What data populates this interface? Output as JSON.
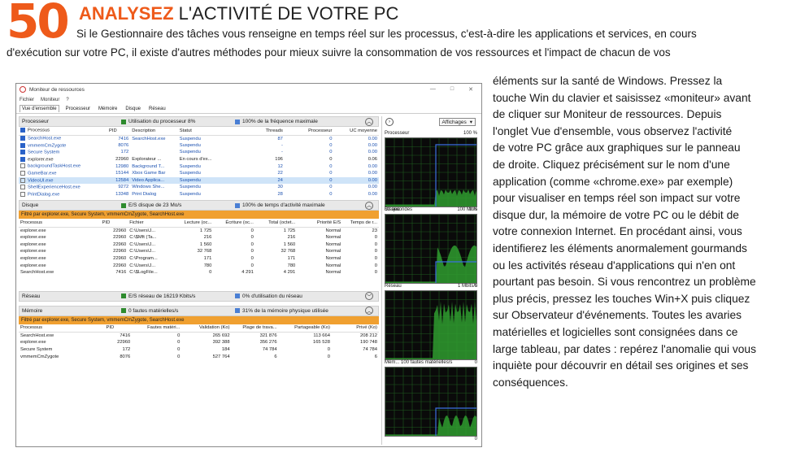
{
  "header": {
    "number": "50",
    "title_strong": "ANALYSEZ",
    "title_rest": "L'ACTIVITÉ DE VOTRE PC"
  },
  "intro": {
    "line1": "Si le Gestionnaire des tâches vous renseigne en temps réel sur les processus, c'est-à-dire les applications et services, en cours",
    "line2": "d'exécution sur votre PC, il existe d'autres méthodes pour mieux suivre la consommation de vos ressources et l'impact de chacun de vos"
  },
  "body_lines": [
    "éléments sur la santé de Windows. Pressez la",
    "touche Win du clavier et saisissez «moniteur» avant",
    "de cliquer sur Moniteur de ressources. Depuis",
    "l'onglet Vue d'ensemble, vous observez l'activité",
    "de votre PC grâce aux graphiques sur le panneau",
    "de droite. Cliquez précisément sur le nom d'une",
    "application (comme «chrome.exe» par exemple)",
    "pour visualiser en temps réel son impact sur votre",
    "disque dur, la mémoire de votre PC ou le débit de",
    "votre connexion Internet. En procédant ainsi, vous",
    "identifierez les éléments anormalement gourmands",
    "ou les activités réseau d'applications qui n'en ont",
    "pourtant pas besoin. Si vous rencontrez un problème",
    "plus précis, pressez les touches Win+X puis cliquez",
    "sur Observateur d'événements. Toutes les avaries",
    "matérielles et logicielles sont consignées dans ce",
    "large tableau, par dates : repérez l'anomalie qui vous",
    "inquiète pour découvrir en détail ses origines et ses",
    "conséquences."
  ],
  "window": {
    "title": "Moniteur de ressources",
    "controls": [
      "—",
      "□",
      "✕"
    ],
    "menu": [
      "Fichier",
      "Moniteur",
      "?"
    ],
    "tabs": [
      "Vue d'ensemble",
      "Processeur",
      "Mémoire",
      "Disque",
      "Réseau"
    ],
    "cpu": {
      "title": "Processeur",
      "info1": "Utilisation du processeur 8%",
      "info2": "100% de la fréquence maximale",
      "headers": [
        "Processus",
        "PID",
        "Description",
        "Statut",
        "Threads",
        "Processeur",
        "UC moyenne"
      ],
      "rows": [
        [
          "SearchHost.exe",
          "7416",
          "SearchHost.exe",
          "Suspendu",
          "87",
          "0",
          "0.00"
        ],
        [
          "vmmemCmZygote",
          "8076",
          "",
          "Suspendu",
          "-",
          "0",
          "0.00"
        ],
        [
          "Secure System",
          "172",
          "",
          "Suspendu",
          "-",
          "0",
          "0.00"
        ],
        [
          "explorer.exe",
          "22960",
          "Explorateur ...",
          "En cours d'ex...",
          "196",
          "0",
          "0.06"
        ],
        [
          "backgroundTaskHost.exe",
          "12980",
          "Background T...",
          "Suspendu",
          "12",
          "0",
          "0.00"
        ],
        [
          "GameBar.exe",
          "15144",
          "Xbox Game Bar",
          "Suspendu",
          "22",
          "0",
          "0.00"
        ],
        [
          "VideoUI.exe",
          "12584",
          "Video Applica...",
          "Suspendu",
          "24",
          "0",
          "0.00"
        ],
        [
          "ShellExperienceHost.exe",
          "9272",
          "Windows She...",
          "Suspendu",
          "30",
          "0",
          "0.00"
        ],
        [
          "PrintDialog.exe",
          "13348",
          "Print Dialog",
          "Suspendu",
          "28",
          "0",
          "0.00"
        ]
      ]
    },
    "disk": {
      "title": "Disque",
      "info1": "E/S disque de 23 Mo/s",
      "info2": "100% de temps d'activité maximale",
      "filter": "Filtré par explorer.exe, Secure System, vmmemCmZygote, SearchHost.exe",
      "headers": [
        "Processus",
        "PID",
        "Fichier",
        "Lecture (oc...",
        "Écriture (oc...",
        "Total (octet...",
        "Priorité E/S",
        "Temps de r..."
      ],
      "rows": [
        [
          "explorer.exe",
          "22960",
          "C:\\Users\\J...",
          "1 725",
          "0",
          "1 725",
          "Normal",
          "23"
        ],
        [
          "explorer.exe",
          "22960",
          "C:\\$Mft (Ta...",
          "216",
          "0",
          "216",
          "Normal",
          "0"
        ],
        [
          "explorer.exe",
          "22960",
          "C:\\Users\\J...",
          "1 560",
          "0",
          "1 560",
          "Normal",
          "0"
        ],
        [
          "explorer.exe",
          "22960",
          "C:\\Users\\J...",
          "32 768",
          "0",
          "32 768",
          "Normal",
          "0"
        ],
        [
          "explorer.exe",
          "22960",
          "C:\\Program...",
          "171",
          "0",
          "171",
          "Normal",
          "0"
        ],
        [
          "explorer.exe",
          "22960",
          "C:\\Users\\J...",
          "780",
          "0",
          "780",
          "Normal",
          "0"
        ],
        [
          "SearchHost.exe",
          "7416",
          "C:\\$LogFile...",
          "0",
          "4 291",
          "4 291",
          "Normal",
          "0"
        ]
      ]
    },
    "network": {
      "title": "Réseau",
      "info1": "E/S réseau de 16219 Kbits/s",
      "info2": "0% d'utilisation du réseau"
    },
    "memory": {
      "title": "Mémoire",
      "info1": "0 fautes matérielles/s",
      "info2": "31% de la mémoire physique utilisée",
      "filter": "Filtré par explorer.exe, Secure System, vmmemCmZygote, SearchHost.exe",
      "headers": [
        "Processus",
        "PID",
        "Fautes matéri...",
        "Validation (Ko)",
        "Plage de trava...",
        "Partageable (Ko)",
        "Privé (Ko)"
      ],
      "rows": [
        [
          "SearchHost.exe",
          "7416",
          "0",
          "265 692",
          "321 876",
          "113 664",
          "208 212"
        ],
        [
          "explorer.exe",
          "22960",
          "0",
          "392 388",
          "356 276",
          "165 528",
          "190 748"
        ],
        [
          "Secure System",
          "172",
          "0",
          "184",
          "74 784",
          "0",
          "74 784"
        ],
        [
          "vmmemCmZygote",
          "8076",
          "0",
          "527 764",
          "6",
          "0",
          "6"
        ]
      ]
    },
    "right_panel": {
      "views_label": "Affichages",
      "graphs": [
        {
          "label": "Processeur",
          "max": "100 %",
          "foot_left": "60 secondes",
          "foot_right": "0 %"
        },
        {
          "label": "Disque",
          "max": "100 Mo/s",
          "foot_left": "",
          "foot_right": "0"
        },
        {
          "label": "Réseau",
          "max": "1 Mbits/s",
          "foot_left": "",
          "foot_right": "0"
        },
        {
          "label": "Mém... 100 fautes matérielles/s",
          "max": "",
          "foot_left": "",
          "foot_right": "0"
        }
      ]
    },
    "colors": {
      "accent_orange": "#ee5a1a",
      "filter_orange": "#f0a030",
      "cpu_green": "#2e8b2e",
      "freq_blue": "#4a7fd4"
    }
  }
}
